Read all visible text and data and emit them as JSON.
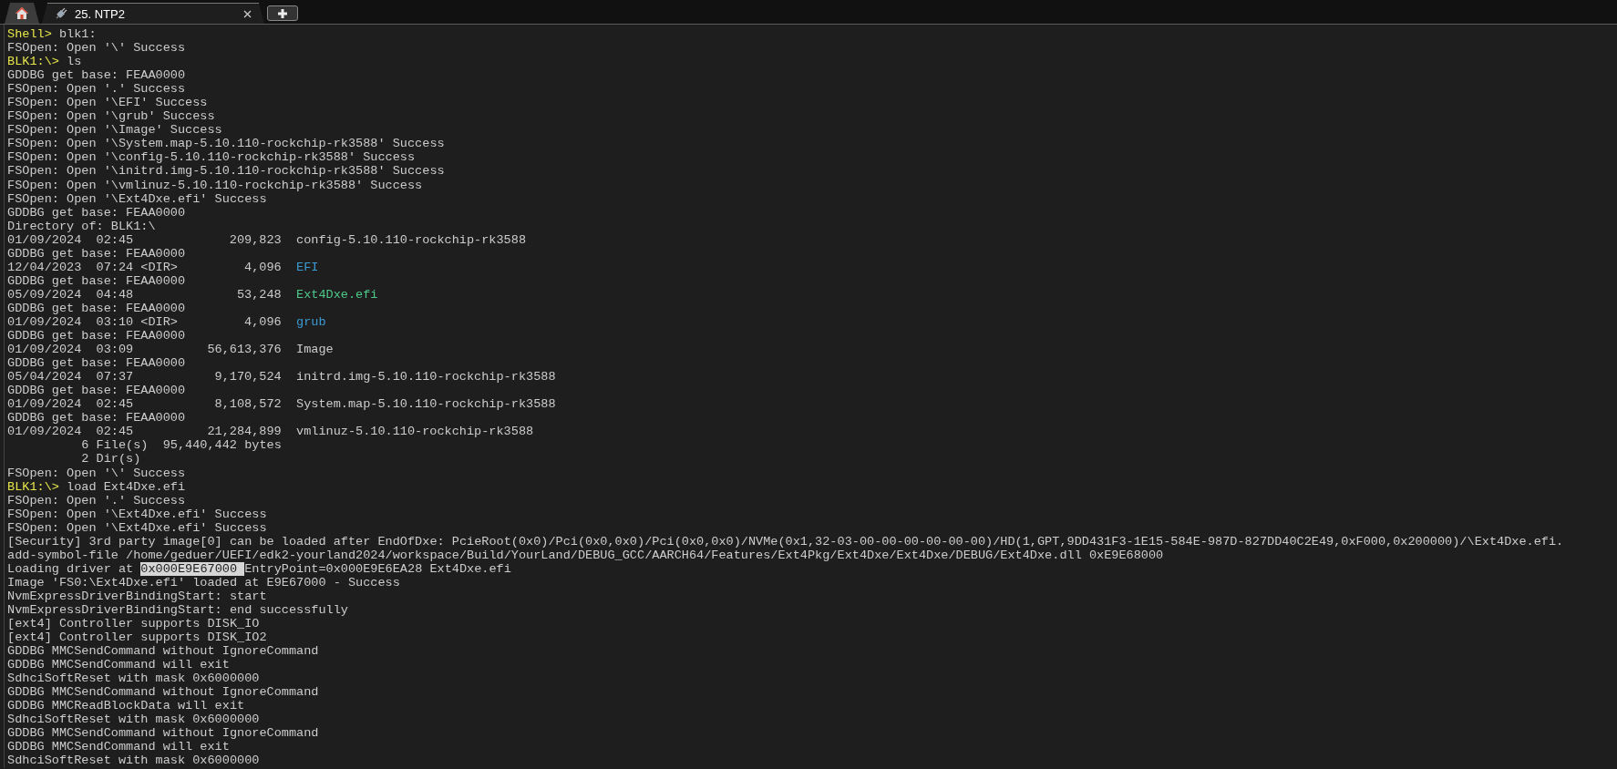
{
  "tabs": [
    {
      "kind": "home",
      "selected": false
    },
    {
      "kind": "session",
      "label": "25. NTP2",
      "selected": true
    }
  ],
  "terminal": {
    "lines": [
      {
        "kind": "prompt",
        "prompt": "Shell>",
        "command": "blk1:"
      },
      {
        "kind": "output",
        "text": "FSOpen: Open '\\' Success"
      },
      {
        "kind": "prompt",
        "prompt": "BLK1:\\>",
        "command": "ls"
      },
      {
        "kind": "output",
        "text": "GDDBG get base: FEAA0000"
      },
      {
        "kind": "output",
        "text": "FSOpen: Open '.' Success"
      },
      {
        "kind": "output",
        "text": "FSOpen: Open '\\EFI' Success"
      },
      {
        "kind": "output",
        "text": "FSOpen: Open '\\grub' Success"
      },
      {
        "kind": "output",
        "text": "FSOpen: Open '\\Image' Success"
      },
      {
        "kind": "output",
        "text": "FSOpen: Open '\\System.map-5.10.110-rockchip-rk3588' Success"
      },
      {
        "kind": "output",
        "text": "FSOpen: Open '\\config-5.10.110-rockchip-rk3588' Success"
      },
      {
        "kind": "output",
        "text": "FSOpen: Open '\\initrd.img-5.10.110-rockchip-rk3588' Success"
      },
      {
        "kind": "output",
        "text": "FSOpen: Open '\\vmlinuz-5.10.110-rockchip-rk3588' Success"
      },
      {
        "kind": "output",
        "text": "FSOpen: Open '\\Ext4Dxe.efi' Success"
      },
      {
        "kind": "output",
        "text": "GDDBG get base: FEAA0000"
      },
      {
        "kind": "output",
        "text": "Directory of: BLK1:\\"
      },
      {
        "kind": "listing",
        "date": "01/09/2024",
        "time": "02:45",
        "size": "209,823",
        "name": "config-5.10.110-rockchip-rk3588",
        "color": "#cccccc"
      },
      {
        "kind": "output",
        "text": "GDDBG get base: FEAA0000"
      },
      {
        "kind": "listing",
        "date": "12/04/2023",
        "time": "07:24",
        "dir": "<DIR>",
        "size": "4,096",
        "name": "EFI",
        "color": "#3a9bd5"
      },
      {
        "kind": "output",
        "text": "GDDBG get base: FEAA0000"
      },
      {
        "kind": "listing",
        "date": "05/09/2024",
        "time": "04:48",
        "size": "53,248",
        "name": "Ext4Dxe.efi",
        "color": "#4ec98a"
      },
      {
        "kind": "output",
        "text": "GDDBG get base: FEAA0000"
      },
      {
        "kind": "listing",
        "date": "01/09/2024",
        "time": "03:10",
        "dir": "<DIR>",
        "size": "4,096",
        "name": "grub",
        "color": "#3a9bd5"
      },
      {
        "kind": "output",
        "text": "GDDBG get base: FEAA0000"
      },
      {
        "kind": "listing",
        "date": "01/09/2024",
        "time": "03:09",
        "size": "56,613,376",
        "name": "Image",
        "color": "#cccccc"
      },
      {
        "kind": "output",
        "text": "GDDBG get base: FEAA0000"
      },
      {
        "kind": "listing",
        "date": "05/04/2024",
        "time": "07:37",
        "size": "9,170,524",
        "name": "initrd.img-5.10.110-rockchip-rk3588",
        "color": "#cccccc"
      },
      {
        "kind": "output",
        "text": "GDDBG get base: FEAA0000"
      },
      {
        "kind": "listing",
        "date": "01/09/2024",
        "time": "02:45",
        "size": "8,108,572",
        "name": "System.map-5.10.110-rockchip-rk3588",
        "color": "#cccccc"
      },
      {
        "kind": "output",
        "text": "GDDBG get base: FEAA0000"
      },
      {
        "kind": "listing",
        "date": "01/09/2024",
        "time": "02:45",
        "size": "21,284,899",
        "name": "vmlinuz-5.10.110-rockchip-rk3588",
        "color": "#cccccc"
      },
      {
        "kind": "summary",
        "text": "6 File(s)  95,440,442 bytes"
      },
      {
        "kind": "summary",
        "text": "2 Dir(s)"
      },
      {
        "kind": "output",
        "text": "FSOpen: Open '\\' Success"
      },
      {
        "kind": "prompt",
        "prompt": "BLK1:\\>",
        "command": "load Ext4Dxe.efi"
      },
      {
        "kind": "output",
        "text": "FSOpen: Open '.' Success"
      },
      {
        "kind": "output",
        "text": "FSOpen: Open '\\Ext4Dxe.efi' Success"
      },
      {
        "kind": "output",
        "text": "FSOpen: Open '\\Ext4Dxe.efi' Success"
      },
      {
        "kind": "output",
        "text": "[Security] 3rd party image[0] can be loaded after EndOfDxe: PcieRoot(0x0)/Pci(0x0,0x0)/Pci(0x0,0x0)/NVMe(0x1,32-03-00-00-00-00-00-00)/HD(1,GPT,9DD431F3-1E15-584E-987D-827DD40C2E49,0xF000,0x200000)/\\Ext4Dxe.efi."
      },
      {
        "kind": "output",
        "text": "add-symbol-file /home/geduer/UEFI/edk2-yourland2024/workspace/Build/YourLand/DEBUG_GCC/AARCH64/Features/Ext4Pkg/Ext4Dxe/Ext4Dxe/DEBUG/Ext4Dxe.dll 0xE9E68000"
      },
      {
        "kind": "selection",
        "before": "Loading driver at",
        "selected": "0x000E9E67000",
        "after": "EntryPoint=0x000E9E6EA28 Ext4Dxe.efi"
      },
      {
        "kind": "output",
        "text": "Image 'FS0:\\Ext4Dxe.efi' loaded at E9E67000 - Success"
      },
      {
        "kind": "output",
        "text": "NvmExpressDriverBindingStart: start"
      },
      {
        "kind": "output",
        "text": "NvmExpressDriverBindingStart: end successfully"
      },
      {
        "kind": "output",
        "text": "[ext4] Controller supports DISK_IO"
      },
      {
        "kind": "output",
        "text": "[ext4] Controller supports DISK_IO2"
      },
      {
        "kind": "output",
        "text": "GDDBG MMCSendCommand without IgnoreCommand"
      },
      {
        "kind": "output",
        "text": "GDDBG MMCSendCommand will exit"
      },
      {
        "kind": "output",
        "text": "SdhciSoftReset with mask 0x6000000"
      },
      {
        "kind": "output",
        "text": "GDDBG MMCSendCommand without IgnoreCommand"
      },
      {
        "kind": "output",
        "text": "GDDBG MMCReadBlockData will exit"
      },
      {
        "kind": "output",
        "text": "SdhciSoftReset with mask 0x6000000"
      },
      {
        "kind": "output",
        "text": "GDDBG MMCSendCommand without IgnoreCommand"
      },
      {
        "kind": "output",
        "text": "GDDBG MMCSendCommand will exit"
      },
      {
        "kind": "output",
        "text": "SdhciSoftReset with mask 0x6000000"
      }
    ]
  }
}
